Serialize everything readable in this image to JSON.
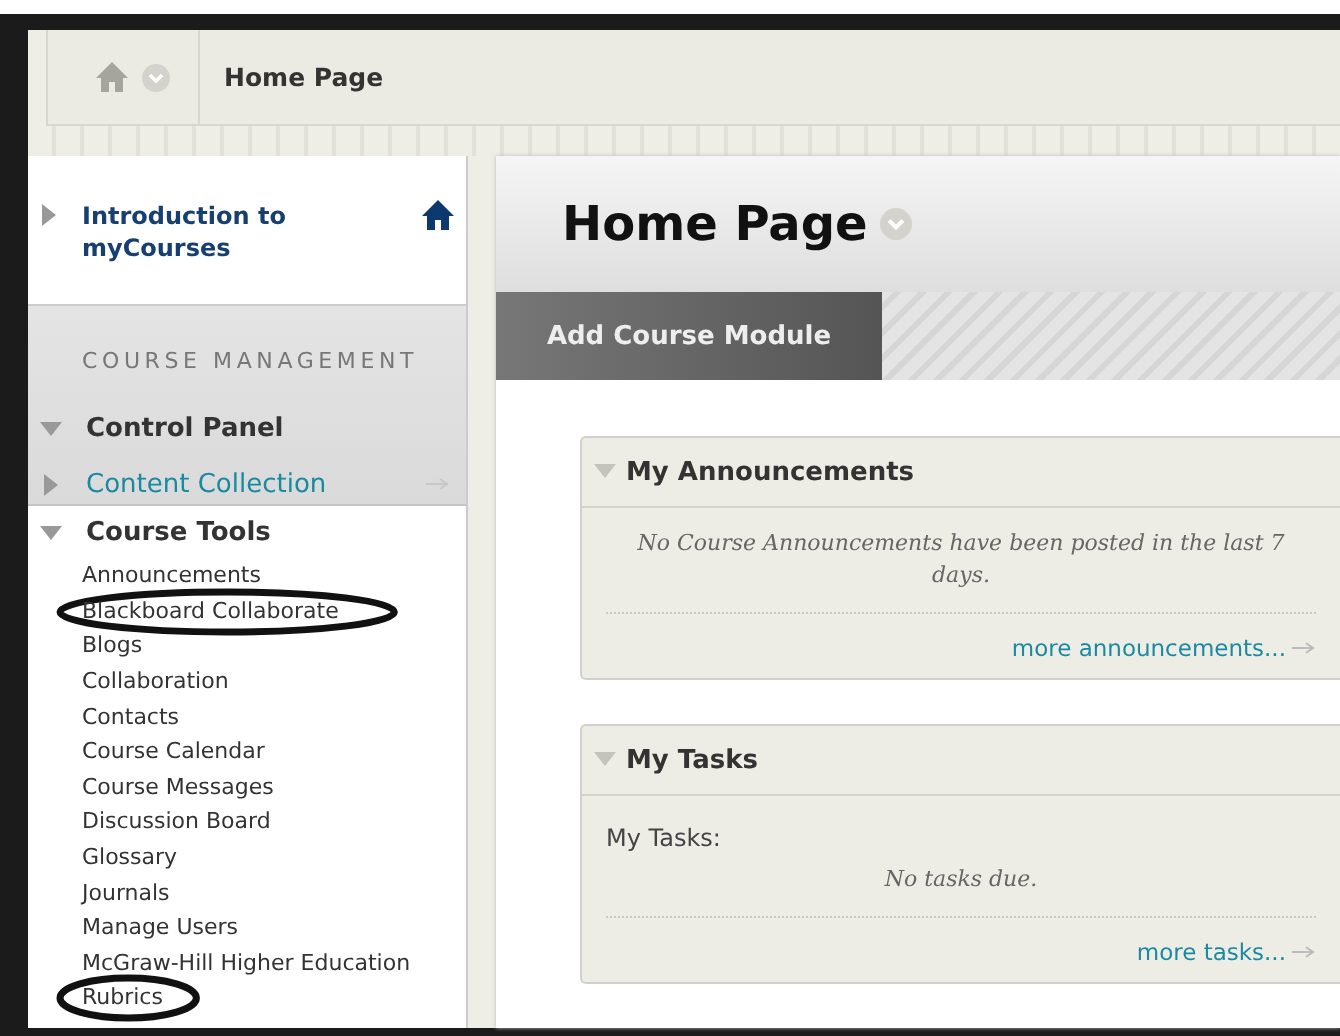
{
  "breadcrumb": {
    "label": "Home Page"
  },
  "course_menu": {
    "course_title": "Introduction to myCourses",
    "section_heading": "COURSE MANAGEMENT",
    "control_panel": {
      "label": "Control Panel",
      "expanded": true
    },
    "panel_items": [
      {
        "label": "Content Collection",
        "expanded": false
      }
    ],
    "course_tools": {
      "label": "Course Tools",
      "expanded": true,
      "items": [
        {
          "label": "Announcements",
          "circled": false
        },
        {
          "label": "Blackboard Collaborate",
          "circled": true
        },
        {
          "label": "Blogs",
          "circled": false
        },
        {
          "label": "Collaboration",
          "circled": false
        },
        {
          "label": "Contacts",
          "circled": false
        },
        {
          "label": "Course Calendar",
          "circled": false
        },
        {
          "label": "Course Messages",
          "circled": false
        },
        {
          "label": "Discussion Board",
          "circled": false
        },
        {
          "label": "Glossary",
          "circled": false
        },
        {
          "label": "Journals",
          "circled": false
        },
        {
          "label": "Manage Users",
          "circled": false
        },
        {
          "label": "McGraw-Hill Higher Education",
          "circled": false
        },
        {
          "label": "Rubrics",
          "circled": true
        }
      ]
    }
  },
  "page": {
    "title": "Home Page",
    "add_module_button": "Add Course Module"
  },
  "modules": [
    {
      "title": "My Announcements",
      "expanded": true,
      "message": "No Course Announcements have been posted in the last 7 days.",
      "link": "more announcements..."
    },
    {
      "title": "My Tasks",
      "expanded": true,
      "label": "My Tasks:",
      "message": "No tasks due.",
      "link": "more tasks..."
    }
  ]
}
